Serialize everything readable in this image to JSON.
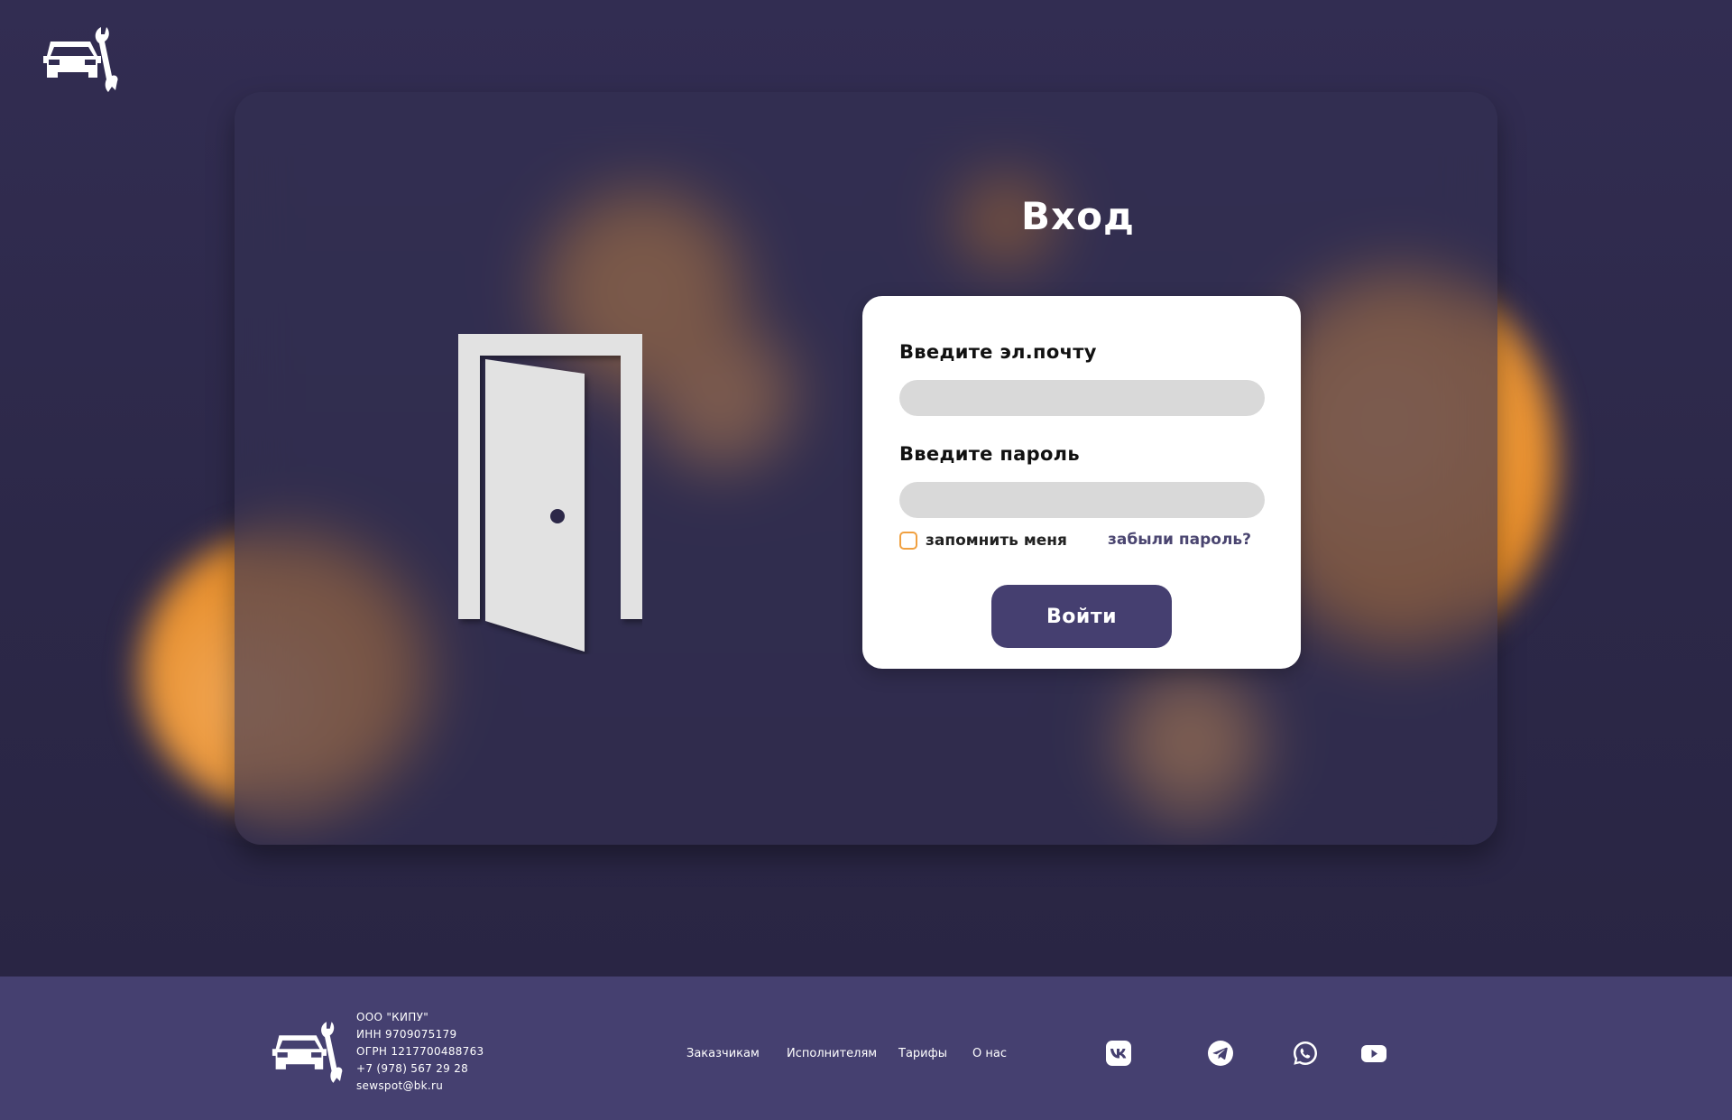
{
  "login": {
    "title": "Вход",
    "email_label": "Введите эл.почту",
    "email_value": "",
    "email_placeholder": "",
    "password_label": "Введите пароль",
    "password_value": "",
    "password_placeholder": "",
    "remember_label": "запомнить меня",
    "remember_checked": false,
    "forgot_label": "забыли пароль?",
    "submit_label": "Войти"
  },
  "footer": {
    "company": {
      "name": "ООО \"КИПУ\"",
      "inn": "ИНН 9709075179",
      "ogrn": "ОГРН 1217700488763",
      "phone": "+7 (978) 567 29 28",
      "email": "sewspot@bk.ru"
    },
    "nav": [
      {
        "label": "Заказчикам"
      },
      {
        "label": "Исполнителям"
      },
      {
        "label": "Тарифы"
      },
      {
        "label": "О нас"
      }
    ],
    "social": [
      {
        "icon": "vk-icon"
      },
      {
        "icon": "telegram-icon"
      },
      {
        "icon": "whatsapp-icon"
      },
      {
        "icon": "youtube-icon"
      }
    ]
  },
  "colors": {
    "background": "#2c2848",
    "accent_orange": "#e88c26",
    "button": "#453f70",
    "footer": "#454070",
    "input": "#d9d9d9"
  }
}
